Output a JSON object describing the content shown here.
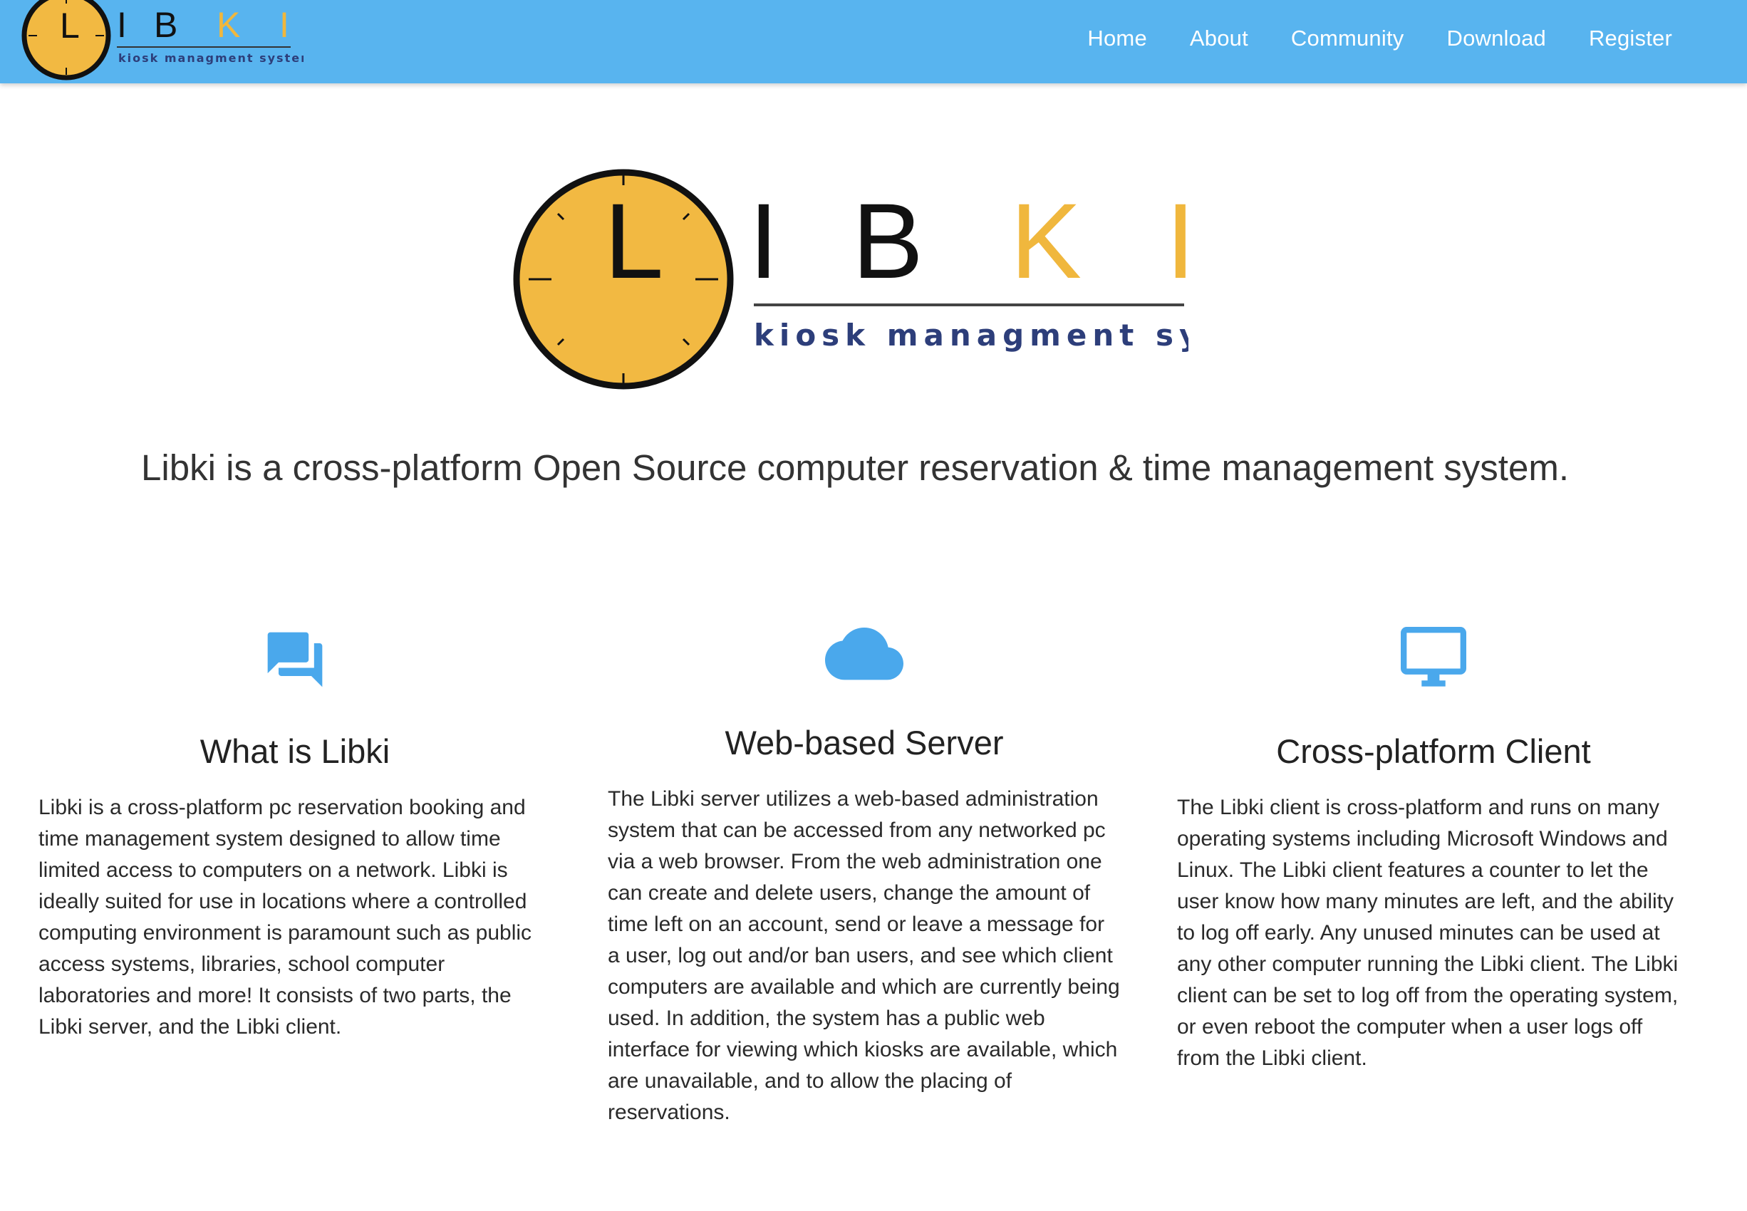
{
  "brand": {
    "letters": [
      "L",
      "I",
      "B",
      "K",
      "I"
    ],
    "subtitle": "kiosk managment system",
    "colors": {
      "clock_face": "#f2b942",
      "clock_rim": "#111111",
      "k_i": "#f0b73d",
      "subtitle": "#2d3e7a"
    }
  },
  "nav": {
    "items": [
      {
        "label": "Home"
      },
      {
        "label": "About"
      },
      {
        "label": "Community"
      },
      {
        "label": "Download"
      },
      {
        "label": "Register"
      }
    ],
    "background": "#58b4ef"
  },
  "tagline": "Libki is a cross-platform Open Source computer reservation & time management system.",
  "features": [
    {
      "icon": "chat-bubbles-icon",
      "title": "What is Libki",
      "body": "Libki is a cross-platform pc reservation booking and time management system designed to allow time limited access to computers on a network. Libki is ideally suited for use in locations where a controlled computing environment is paramount such as public access systems, libraries, school computer laboratories and more! It consists of two parts, the Libki server, and the Libki client."
    },
    {
      "icon": "cloud-icon",
      "title": "Web-based Server",
      "body": "The Libki server utilizes a web-based administration system that can be accessed from any networked pc via a web browser. From the web administration one can create and delete users, change the amount of time left on an account, send or leave a message for a user, log out and/or ban users, and see which client computers are available and which are currently being used. In addition, the system has a public web interface for viewing which kiosks are available, which are unavailable, and to allow the placing of reservations."
    },
    {
      "icon": "monitor-icon",
      "title": "Cross-platform Client",
      "body": "The Libki client is cross-platform and runs on many operating systems including Microsoft Windows and Linux. The Libki client features a counter to let the user know how many minutes are left, and the ability to log off early. Any unused minutes can be used at any other computer running the Libki client. The Libki client can be set to log off from the operating system, or even reboot the computer when a user logs off from the Libki client."
    }
  ],
  "icon_color": "#4aa8ec"
}
